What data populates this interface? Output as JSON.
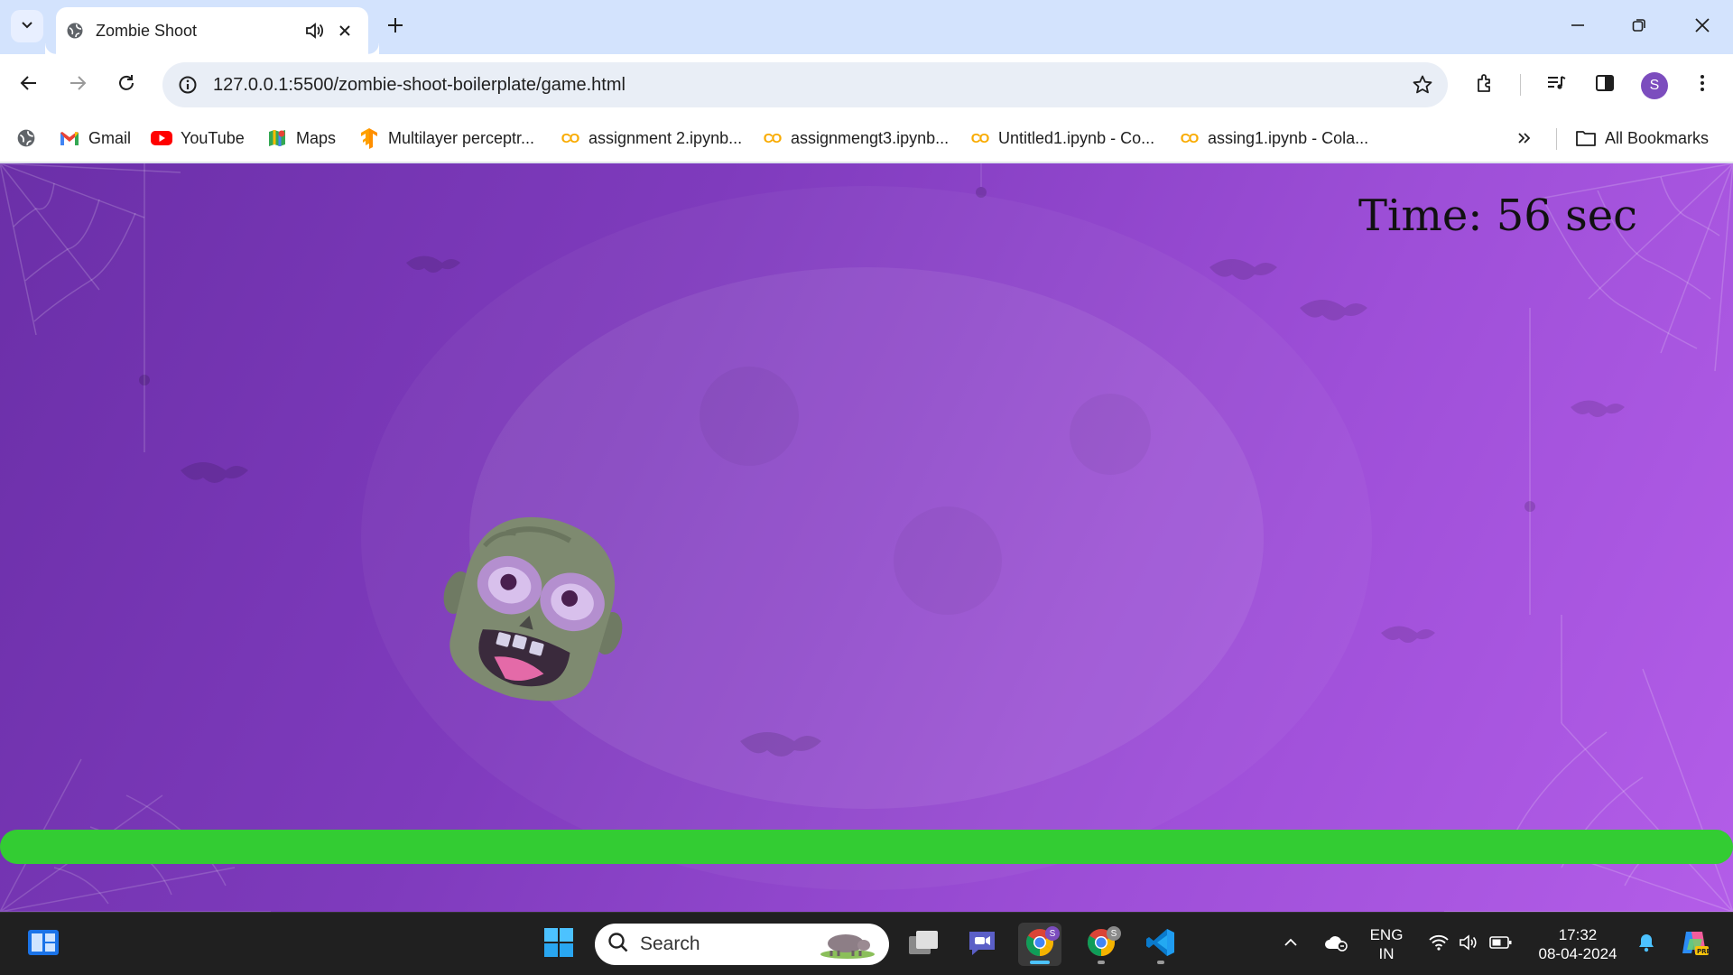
{
  "browser": {
    "tab": {
      "title": "Zombie Shoot",
      "favicon": "globe-icon",
      "audio_icon": "speaker-icon",
      "close_icon": "close-icon"
    },
    "new_tab_icon": "plus-icon",
    "url": "127.0.0.1:5500/zombie-shoot-boilerplate/game.html",
    "profile_initial": "S",
    "profile_color": "#7c4dbe",
    "toolbar_icons": [
      "back-icon",
      "forward-icon",
      "reload-icon",
      "site-info-icon",
      "bookmark-star-icon",
      "extensions-icon",
      "media-controls-icon",
      "side-panel-icon",
      "menu-icon"
    ],
    "window_controls": [
      "minimize-icon",
      "restore-icon",
      "close-icon"
    ]
  },
  "bookmarks": {
    "items": [
      {
        "label": "Gmail",
        "icon": "gmail-icon"
      },
      {
        "label": "YouTube",
        "icon": "youtube-icon"
      },
      {
        "label": "Maps",
        "icon": "maps-icon"
      },
      {
        "label": "Multilayer perceptr...",
        "icon": "tensorflow-icon"
      },
      {
        "label": "assignment 2.ipynb...",
        "icon": "colab-icon"
      },
      {
        "label": "assignmengt3.ipynb...",
        "icon": "colab-icon"
      },
      {
        "label": "Untitled1.ipynb - Co...",
        "icon": "colab-icon"
      },
      {
        "label": "assing1.ipynb - Cola...",
        "icon": "colab-icon"
      }
    ],
    "all_bookmarks": "All Bookmarks",
    "colab_glyph": "CO"
  },
  "game": {
    "timer_text": "Time: 56 sec",
    "health_fraction": 1.0,
    "health_color": "#33cc33",
    "background_color": "#8a42c6",
    "sprite": "zombie-head"
  },
  "taskbar": {
    "search_placeholder": "Search",
    "language_line1": "ENG",
    "language_line2": "IN",
    "time": "17:32",
    "date": "08-04-2024",
    "profile_badge": "S",
    "apps": [
      "widgets-icon",
      "start-icon",
      "task-view-icon",
      "meet-icon",
      "chrome-icon",
      "chrome-profile-icon",
      "vscode-icon"
    ]
  }
}
